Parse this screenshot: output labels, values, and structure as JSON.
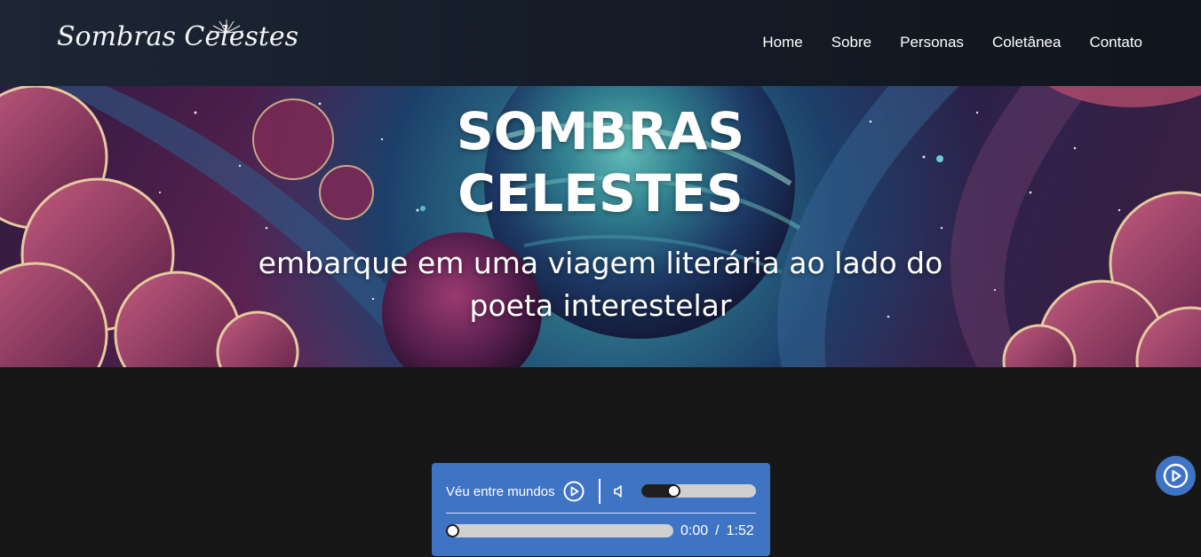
{
  "header": {
    "logo_text": "Sombras Celestes",
    "nav": [
      "Home",
      "Sobre",
      "Personas",
      "Coletânea",
      "Contato"
    ]
  },
  "hero": {
    "title_line1": "SOMBRAS",
    "title_line2": "CELESTES",
    "subtitle": "embarque em uma viagem literária ao lado do poeta interestelar"
  },
  "player": {
    "track_name": "Véu entre mundos",
    "volume_level": 0.28,
    "progress": 0,
    "current_time": "0:00",
    "time_separator": "/",
    "duration": "1:52",
    "icons": {
      "play": "play-circle-icon",
      "volume": "speaker-icon"
    }
  },
  "floating_button": {
    "icon": "play-circle-icon"
  },
  "colors": {
    "page_bg": "#171717",
    "header_bg": "#161d29",
    "player_bg": "#3f73c4",
    "slider_track": "#cfcfcf",
    "slider_fill": "#1f1f1f"
  }
}
